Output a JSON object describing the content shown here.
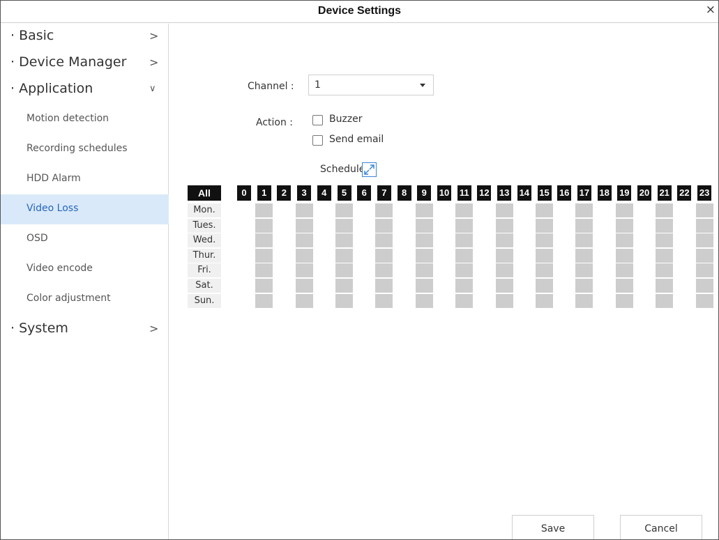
{
  "window": {
    "title": "Device Settings",
    "close_glyph": "×"
  },
  "sidebar": {
    "basic": {
      "label": "· Basic",
      "chevron": ">"
    },
    "device_manager": {
      "label": "· Device Manager",
      "chevron": ">"
    },
    "application": {
      "label": "· Application",
      "chevron": "∨"
    },
    "sub_items": [
      "Motion detection",
      "Recording schedules",
      "HDD Alarm",
      "Video Loss",
      "OSD",
      "Video encode",
      "Color adjustment"
    ],
    "active_item": "Video Loss",
    "system": {
      "label": "· System",
      "chevron": ">"
    }
  },
  "form": {
    "channel_label": "Channel :",
    "channel_value": "1",
    "action_label": "Action :",
    "buzzer_label": "Buzzer",
    "buzzer_checked": false,
    "send_email_label": "Send email",
    "send_email_checked": false,
    "schedule_label": "Schedule",
    "expand_icon": "expand-icon"
  },
  "schedule": {
    "all_label": "All",
    "hours": [
      "0",
      "1",
      "2",
      "3",
      "4",
      "5",
      "6",
      "7",
      "8",
      "9",
      "10",
      "11",
      "12",
      "13",
      "14",
      "15",
      "16",
      "17",
      "18",
      "19",
      "20",
      "21",
      "22",
      "23"
    ],
    "days": [
      "Mon.",
      "Tues.",
      "Wed.",
      "Thur.",
      "Fri.",
      "Sat.",
      "Sun."
    ],
    "selected_color": "#cdcdcd"
  },
  "footer": {
    "save_label": "Save",
    "cancel_label": "Cancel"
  },
  "colors": {
    "active_bg": "#d9e9f9",
    "active_text": "#2766bd",
    "hour_bg": "#111111",
    "accent": "#3a86d6"
  }
}
